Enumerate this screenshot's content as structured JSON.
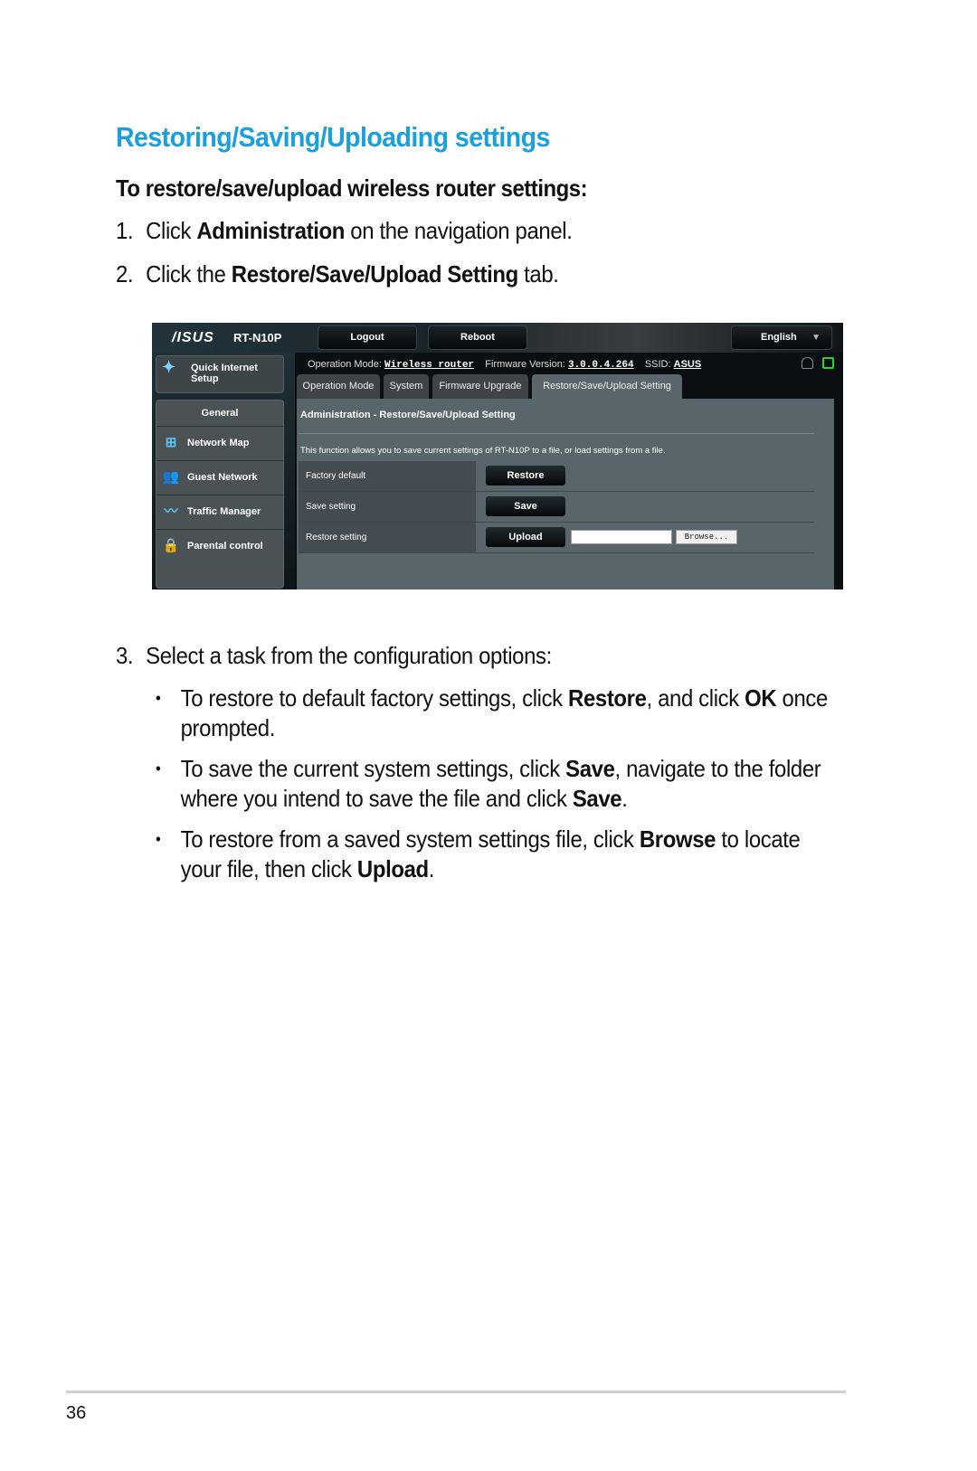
{
  "doc": {
    "section_title": "Restoring/Saving/Uploading settings",
    "subheading": "To restore/save/upload wireless router settings:",
    "steps": [
      {
        "num": "1.",
        "pre": "Click ",
        "bold": "Administration",
        "post": " on the navigation panel."
      },
      {
        "num": "2.",
        "pre": "Click the ",
        "bold": "Restore/Save/Upload Setting",
        "post": " tab."
      },
      {
        "num": "3.",
        "text": "Select a task from the configuration options:"
      }
    ],
    "bullets": [
      {
        "p1": "To restore to default factory settings, click ",
        "b1": "Restore",
        "p2": ", and click ",
        "b2": "OK",
        "p3": " once prompted."
      },
      {
        "p1": "To save the current system settings, click ",
        "b1": "Save",
        "p2": ", navigate to the folder where you intend to save the file and click ",
        "b2": "Save",
        "p3": "."
      },
      {
        "p1": "To restore from a saved system settings file, click ",
        "b1": "Browse",
        "p2": " to locate your file, then click ",
        "b2": "Upload",
        "p3": "."
      }
    ],
    "bullet_glyph": "•",
    "page_number": "36",
    "accent_color": "#1aa0dc"
  },
  "router_ui": {
    "logo": "/ISUS",
    "model": "RT-N10P",
    "buttons": {
      "logout": "Logout",
      "reboot": "Reboot"
    },
    "language": {
      "selected": "English",
      "chevron": "▼"
    },
    "status": {
      "op_mode_label": "Operation Mode:",
      "op_mode_value": "Wireless router",
      "firmware_label": "Firmware Version:",
      "firmware_value": "3.0.0.4.264",
      "ssid_label": "SSID:",
      "ssid_value": "ASUS"
    },
    "status_icons": [
      "clients-icon",
      "network-status-icon"
    ],
    "sidebar": {
      "quick_setup": "Quick Internet Setup",
      "group_title": "General",
      "items": [
        {
          "label": "Network Map",
          "icon": "network-map-icon"
        },
        {
          "label": "Guest Network",
          "icon": "guest-network-icon"
        },
        {
          "label": "Traffic Manager",
          "icon": "traffic-manager-icon"
        },
        {
          "label": "Parental control",
          "icon": "lock-icon"
        }
      ]
    },
    "tabs": [
      {
        "label": "Operation Mode",
        "active": false
      },
      {
        "label": "System",
        "active": false
      },
      {
        "label": "Firmware Upgrade",
        "active": false
      },
      {
        "label": "Restore/Save/Upload Setting",
        "active": true
      }
    ],
    "content": {
      "title": "Administration - Restore/Save/Upload Setting",
      "description": "This function allows you to save current settings of RT-N10P to a file, or load settings from a file.",
      "rows": [
        {
          "label": "Factory default",
          "button": "Restore"
        },
        {
          "label": "Save setting",
          "button": "Save"
        },
        {
          "label": "Restore setting",
          "button": "Upload",
          "file_value": "",
          "browse": "Browse..."
        }
      ]
    }
  }
}
